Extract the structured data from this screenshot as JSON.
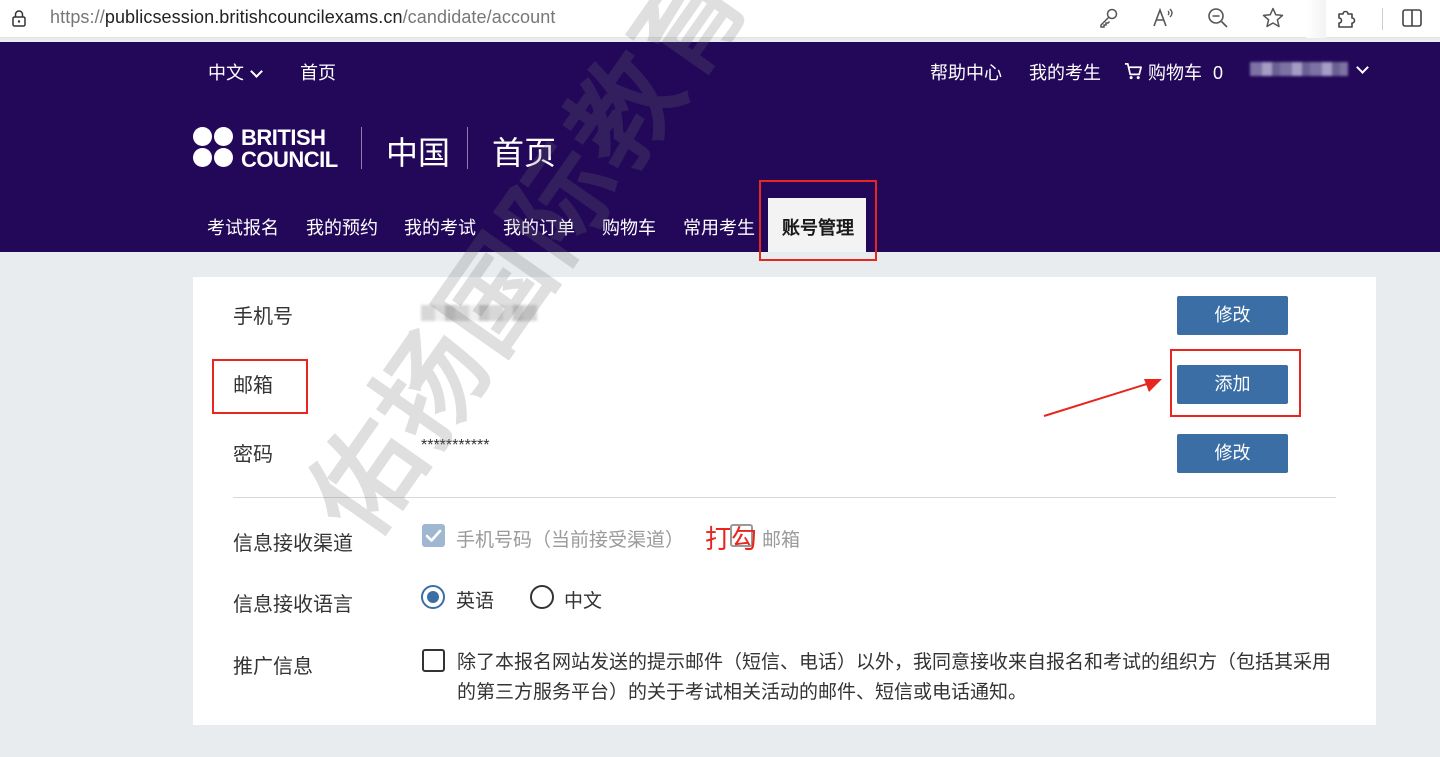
{
  "browser": {
    "url_host_prefix": "https://",
    "url_host": "publicsession.britishcouncilexams.cn",
    "url_path": "/candidate/account",
    "icons": [
      "lock-icon",
      "key-icon",
      "read-aloud-icon",
      "zoom-out-icon",
      "favorite-star-icon",
      "extensions-icon",
      "split-screen-icon"
    ]
  },
  "topnav": {
    "language": "中文",
    "home": "首页",
    "help": "帮助中心",
    "my_candidates": "我的考生",
    "cart_label": "购物车",
    "cart_count": "0"
  },
  "brand": {
    "logo_line1": "BRITISH",
    "logo_line2": "COUNCIL",
    "region": "中国",
    "page_title": "首页"
  },
  "mainnav": {
    "items": [
      "考试报名",
      "我的预约",
      "我的考试",
      "我的订单",
      "购物车",
      "常用考生"
    ],
    "active": "账号管理"
  },
  "account": {
    "phone_label": "手机号",
    "phone_button": "修改",
    "email_label": "邮箱",
    "email_button": "添加",
    "password_label": "密码",
    "password_value": "***********",
    "password_button": "修改",
    "channel_label": "信息接收渠道",
    "channel_options": [
      {
        "label": "手机号码（当前接受渠道）",
        "checked": true,
        "disabled": true
      },
      {
        "label": "邮箱",
        "checked": false
      }
    ],
    "language_label": "信息接收语言",
    "language_options": [
      {
        "label": "英语",
        "selected": true
      },
      {
        "label": "中文",
        "selected": false
      }
    ],
    "promo_label": "推广信息",
    "promo_text": "除了本报名网站发送的提示邮件（短信、电话）以外，我同意接收来自报名和考试的组织方（包括其采用的第三方服务平台）的关于考试相关活动的邮件、短信或电话通知。",
    "promo_checked": false
  },
  "annotations": {
    "tick_note": "打勾",
    "color": "#e8251e"
  },
  "watermark": "佑扬国际教育",
  "colors": {
    "header_bg": "#23085a",
    "button_bg": "#3a6ea5",
    "page_bg": "#e8ecef"
  }
}
